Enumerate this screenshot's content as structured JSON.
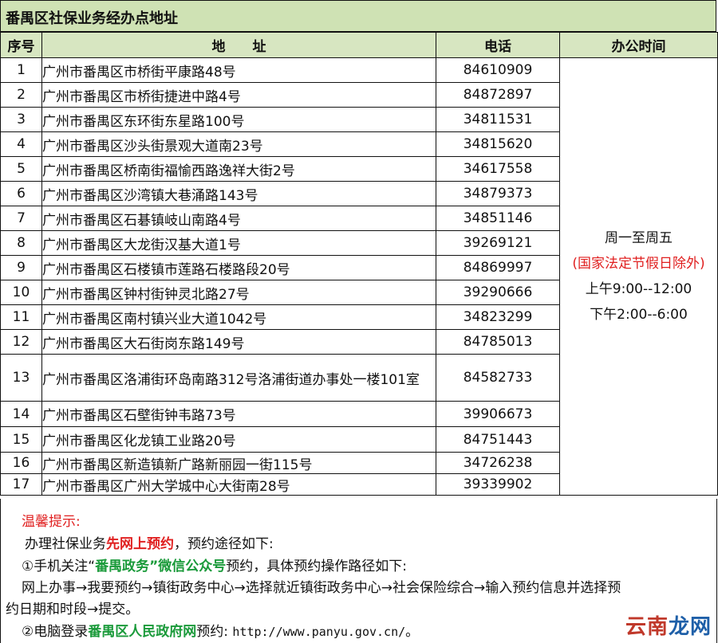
{
  "title": "番禺区社保业务经办点地址",
  "headers": {
    "num": "序号",
    "addr": "地　　址",
    "phone": "电话",
    "hours": "办公时间"
  },
  "rows": [
    {
      "num": "1",
      "addr": "广州市番禺区市桥街平康路48号",
      "phone": "84610909"
    },
    {
      "num": "2",
      "addr": "广州市番禺区市桥街捷进中路4号",
      "phone": "84872897"
    },
    {
      "num": "3",
      "addr": "广州市番禺区东环街东星路100号",
      "phone": "34811531"
    },
    {
      "num": "4",
      "addr": "广州市番禺区沙头街景观大道南23号",
      "phone": "34815620"
    },
    {
      "num": "5",
      "addr": "广州市番禺区桥南街福愉西路逸祥大街2号",
      "phone": "34617558"
    },
    {
      "num": "6",
      "addr": "广州市番禺区沙湾镇大巷涌路143号",
      "phone": "34879373"
    },
    {
      "num": "7",
      "addr": "广州市番禺区石碁镇岐山南路4号",
      "phone": "34851146"
    },
    {
      "num": "8",
      "addr": "广州市番禺区大龙街汉基大道1号",
      "phone": "39269121"
    },
    {
      "num": "9",
      "addr": "广州市番禺区石楼镇市莲路石楼路段20号",
      "phone": "84869997"
    },
    {
      "num": "10",
      "addr": "广州市番禺区钟村街钟灵北路27号",
      "phone": "39290666"
    },
    {
      "num": "11",
      "addr": "广州市番禺区南村镇兴业大道1042号",
      "phone": "34823299"
    },
    {
      "num": "12",
      "addr": "广州市番禺区大石街岗东路149号",
      "phone": "84785013"
    },
    {
      "num": "13",
      "addr": "广州市番禺区洛浦街环岛南路312号洛浦街道办事处一楼101室",
      "phone": "84582733"
    },
    {
      "num": "14",
      "addr": "广州市番禺区石壁街钟韦路73号",
      "phone": "39906673"
    },
    {
      "num": "15",
      "addr": "广州市番禺区化龙镇工业路20号",
      "phone": "84751443"
    },
    {
      "num": "16",
      "addr": "广州市番禺区新造镇新广路新丽园一街115号",
      "phone": "34726238"
    },
    {
      "num": "17",
      "addr": "广州市番禺区广州大学城中心大街南28号",
      "phone": "39339902"
    }
  ],
  "hours": {
    "days": "周一至周五",
    "holiday_note": "(国家法定节假日除外)",
    "morning": "上午9:00--12:00",
    "afternoon": "下午2:00--6:00"
  },
  "tips": {
    "heading": "温馨提示:",
    "line1_pre": "办理社保业务",
    "line1_em": "先网上预约",
    "line1_post": "，预约途径如下:",
    "line2_pre": "①手机关注“",
    "line2_em1": "番禺政务",
    "line2_mid": "”",
    "line2_em2": "微信公众号",
    "line2_post": "预约，具体预约操作路径如下:",
    "line3": "网上办事→我要预约→镇街政务中心→选择就近镇街政务中心→社会保险综合→输入预约信息并选择预",
    "line4": "约日期和时段→提交。",
    "line5_pre": "②电脑登录",
    "line5_em": "番禺区人民政府网",
    "line5_mid": "预约:",
    "line5_url": "http://www.panyu.gov.cn/",
    "line5_post": "。"
  },
  "watermark": {
    "part1": "云南",
    "part2": "龙网"
  },
  "colors": {
    "header_bg": "#d7e6c1",
    "title_bg": "#cfe2b4",
    "red": "#e02020",
    "green": "#1a9a3a"
  }
}
